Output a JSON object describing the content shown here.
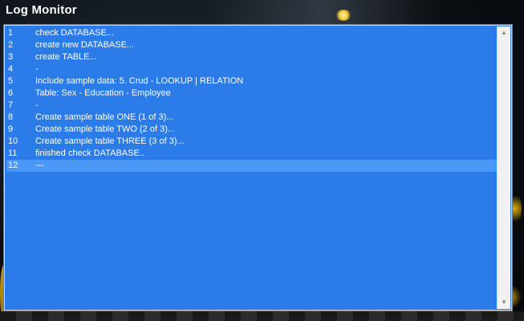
{
  "window": {
    "title": "Log Monitor"
  },
  "log": {
    "selected_index": 11,
    "rows": [
      {
        "num": "1",
        "text": "check DATABASE..."
      },
      {
        "num": "2",
        "text": "create new DATABASE..."
      },
      {
        "num": "3",
        "text": "create TABLE..."
      },
      {
        "num": "4",
        "text": "-"
      },
      {
        "num": "5",
        "text": "Include sample data: 5. Crud - LOOKUP | RELATION"
      },
      {
        "num": "6",
        "text": "Table: Sex - Education - Employee"
      },
      {
        "num": "7",
        "text": "-"
      },
      {
        "num": "8",
        "text": "Create sample table ONE (1 of 3)..."
      },
      {
        "num": "9",
        "text": "Create sample table TWO (2 of 3)..."
      },
      {
        "num": "10",
        "text": "Create sample table THREE (3 of 3)..."
      },
      {
        "num": "11",
        "text": "finished check DATABASE.."
      },
      {
        "num": "12",
        "text": "---"
      }
    ]
  },
  "scrollbar": {
    "up_icon": "scroll-up-arrow",
    "down_icon": "scroll-down-arrow"
  },
  "colors": {
    "log_background": "#2b7be9",
    "selected_row": "#4a97f5",
    "text": "#ffffff"
  }
}
